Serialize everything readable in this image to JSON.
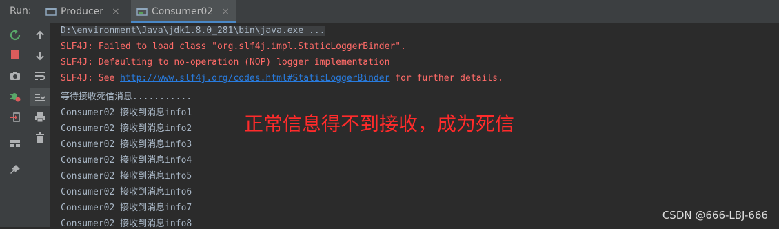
{
  "run_panel": {
    "label": "Run:",
    "tabs": [
      {
        "label": "Producer",
        "close": "×"
      },
      {
        "label": "Consumer02",
        "close": "×"
      }
    ]
  },
  "toolbar_icons": {
    "left": [
      "rerun-icon",
      "stop-icon",
      "camera-icon",
      "debug-icon",
      "login-icon",
      "layout-icon",
      "pin-icon"
    ],
    "right": [
      "up-arrow-icon",
      "down-arrow-icon",
      "soft-wrap-icon",
      "scroll-to-end-icon",
      "print-icon",
      "trash-icon"
    ]
  },
  "console": {
    "path_line": "D:\\environment\\Java\\jdk1.8.0_281\\bin\\java.exe ...",
    "error_lines": [
      "SLF4J: Failed to load class \"org.slf4j.impl.StaticLoggerBinder\".",
      "SLF4J: Defaulting to no-operation (NOP) logger implementation"
    ],
    "see_line": {
      "prefix": "SLF4J: See ",
      "link": "http://www.slf4j.org/codes.html#StaticLoggerBinder",
      "suffix": " for further details."
    },
    "waiting_line": "等待接收死信消息...........",
    "messages": [
      "Consumer02 接收到消息info1",
      "Consumer02 接收到消息info2",
      "Consumer02 接收到消息info3",
      "Consumer02 接收到消息info4",
      "Consumer02 接收到消息info5",
      "Consumer02 接收到消息info6",
      "Consumer02 接收到消息info7",
      "Consumer02 接收到消息info8"
    ]
  },
  "annotation": "正常信息得不到接收，成为死信",
  "watermark": "CSDN @666-LBJ-666",
  "colors": {
    "background": "#2b2b2b",
    "error_text": "#ff6b68",
    "link": "#287bde",
    "annotation": "#ff2b2b",
    "tab_underline": "#4a88c7"
  }
}
